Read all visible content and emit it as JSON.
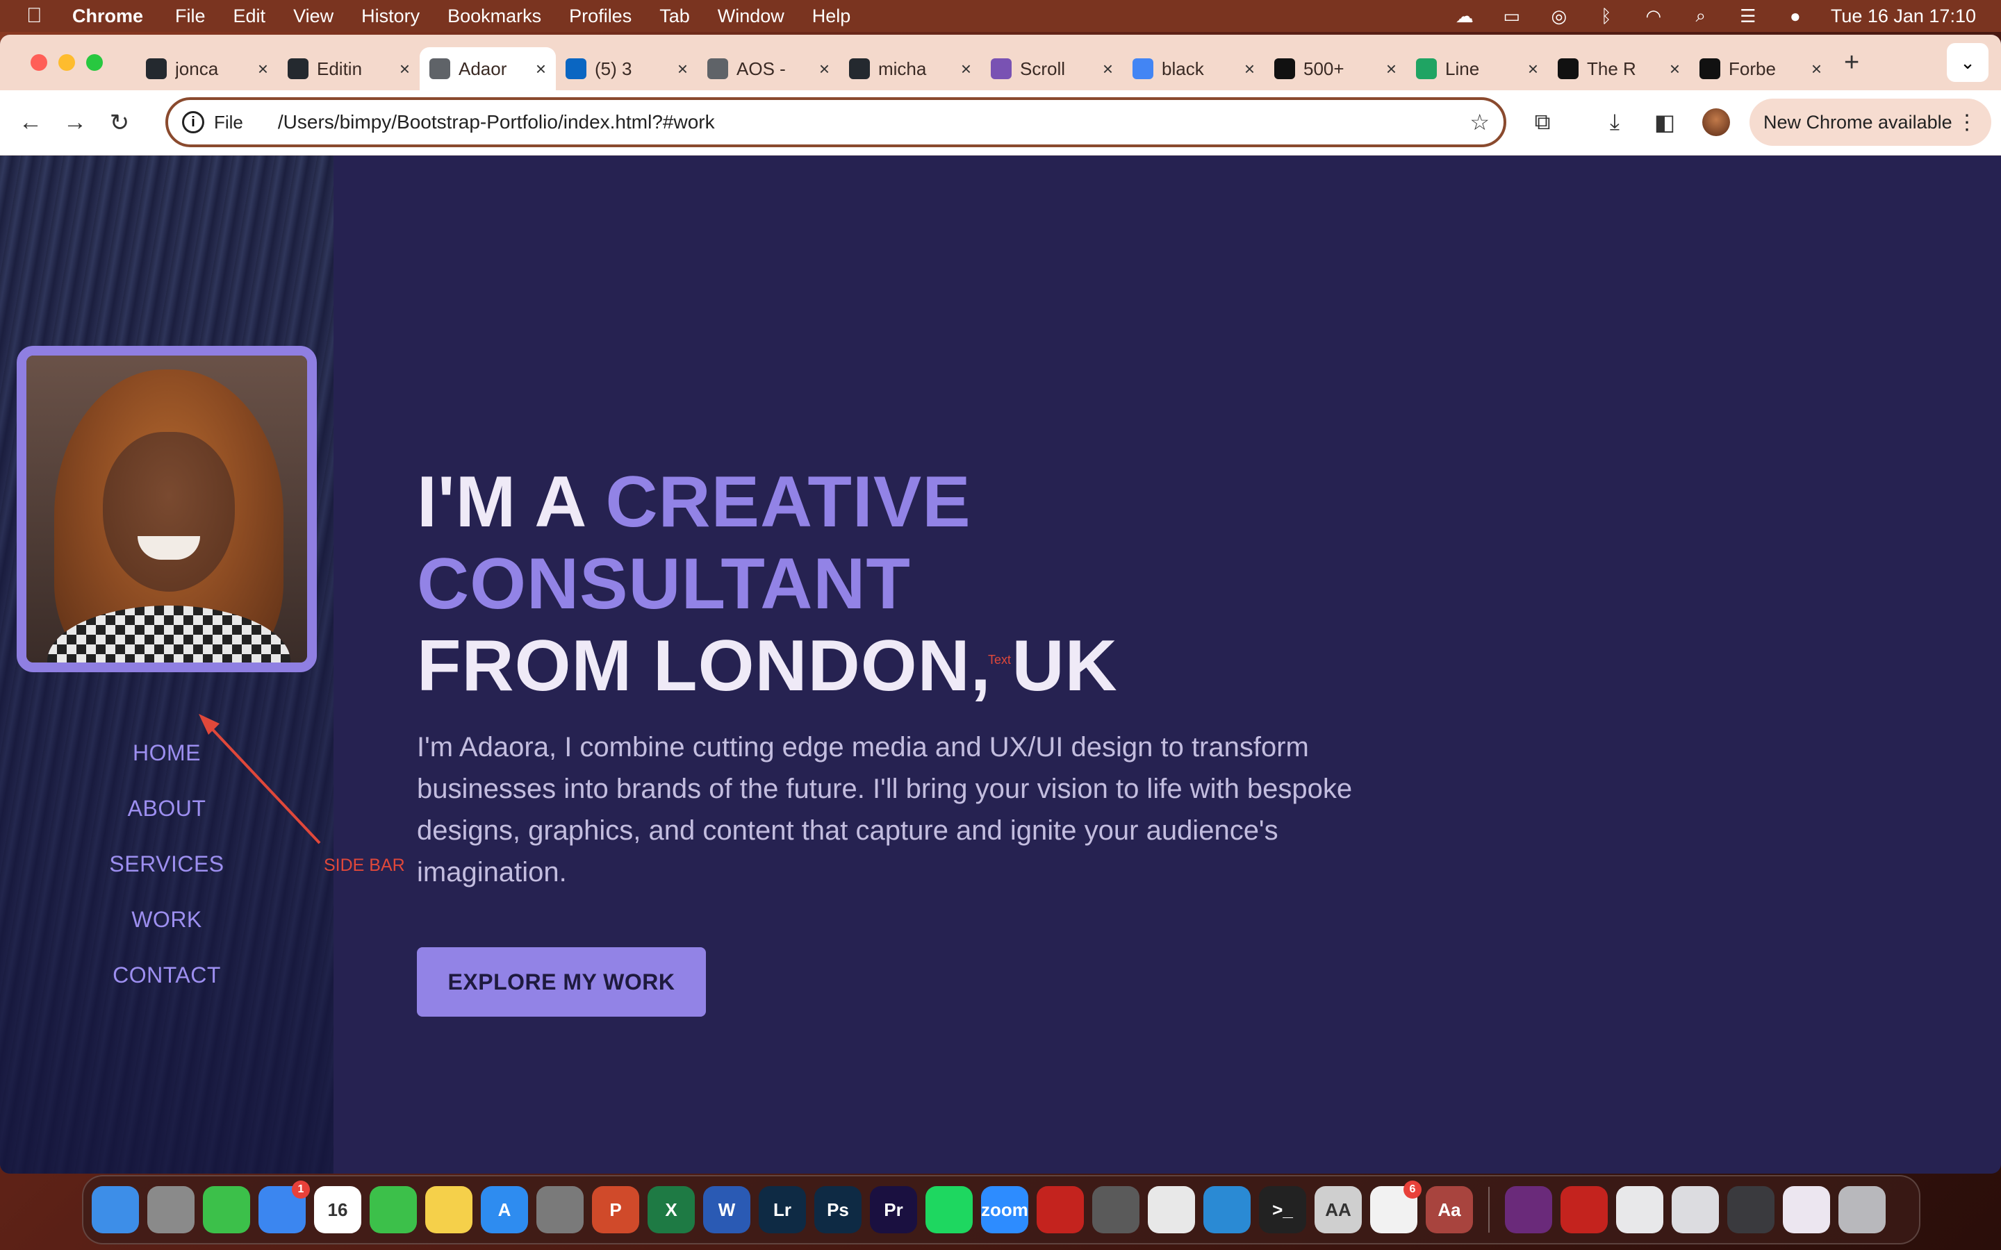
{
  "menubar": {
    "app": "Chrome",
    "items": [
      "File",
      "Edit",
      "View",
      "History",
      "Bookmarks",
      "Profiles",
      "Tab",
      "Window",
      "Help"
    ],
    "clock": "Tue 16 Jan  17:10"
  },
  "tabs": [
    {
      "label": "jonca",
      "icon": "github-icon",
      "color": "#24292f"
    },
    {
      "label": "Editin",
      "icon": "github-icon",
      "color": "#24292f"
    },
    {
      "label": "Adaor",
      "icon": "globe-icon",
      "color": "#5f6368",
      "active": true
    },
    {
      "label": "(5) 3",
      "icon": "linkedin-icon",
      "color": "#0a66c2"
    },
    {
      "label": "AOS -",
      "icon": "globe-icon",
      "color": "#5f6368"
    },
    {
      "label": "micha",
      "icon": "github-icon",
      "color": "#24292f"
    },
    {
      "label": "Scroll",
      "icon": "bootstrap-icon",
      "color": "#7952b3"
    },
    {
      "label": "black",
      "icon": "google-icon",
      "color": "#4285f4"
    },
    {
      "label": "500+",
      "icon": "unsplash-icon",
      "color": "#111111"
    },
    {
      "label": "Line",
      "icon": "sheets-icon",
      "color": "#1fa463"
    },
    {
      "label": "The R",
      "icon": "medium-icon",
      "color": "#111111"
    },
    {
      "label": "Forbe",
      "icon": "forbes-icon",
      "color": "#111111"
    }
  ],
  "omnibox": {
    "scheme": "File",
    "url": "/Users/bimpy/Bootstrap-Portfolio/index.html?#work"
  },
  "update_label": "New Chrome available",
  "sidebar": {
    "nav": [
      "HOME",
      "ABOUT",
      "SERVICES",
      "WORK",
      "CONTACT"
    ]
  },
  "hero": {
    "line1_prefix": "I'M A ",
    "line1_accent": "CREATIVE CONSULTANT",
    "line2": "FROM LONDON, UK",
    "body": "I'm Adaora, I combine cutting edge media and UX/UI design to transform businesses into brands of the future. I'll bring your vision to life with bespoke designs, graphics, and content that capture and ignite your audience's imagination.",
    "cta": "EXPLORE MY WORK"
  },
  "annotations": {
    "sidebar_label": "SIDE BAR",
    "text_label": "Text"
  },
  "colors": {
    "accent": "#9283e6",
    "page_bg": "#262251",
    "annotation": "#e0483a"
  },
  "dock": {
    "apps": [
      {
        "name": "finder-icon",
        "label": "",
        "color": "#3d8ee8"
      },
      {
        "name": "launchpad-icon",
        "label": "",
        "color": "#8a8a8a"
      },
      {
        "name": "messages-icon",
        "label": "",
        "color": "#3cc04a"
      },
      {
        "name": "mail-icon",
        "label": "",
        "color": "#3b86f0",
        "badge": "1"
      },
      {
        "name": "calendar-icon",
        "label": "16",
        "color": "#ffffff"
      },
      {
        "name": "facetime-icon",
        "label": "",
        "color": "#3cc04a"
      },
      {
        "name": "notes-icon",
        "label": "",
        "color": "#f5d04a"
      },
      {
        "name": "app-store-icon",
        "label": "A",
        "color": "#2e8cf0"
      },
      {
        "name": "system-settings-icon",
        "label": "",
        "color": "#7a7a7a"
      },
      {
        "name": "powerpoint-icon",
        "label": "P",
        "color": "#d04a2a"
      },
      {
        "name": "excel-icon",
        "label": "X",
        "color": "#1e7a44"
      },
      {
        "name": "word-icon",
        "label": "W",
        "color": "#2a5ab4"
      },
      {
        "name": "lightroom-icon",
        "label": "Lr",
        "color": "#0e2a44"
      },
      {
        "name": "photoshop-icon",
        "label": "Ps",
        "color": "#0e2a44"
      },
      {
        "name": "premiere-icon",
        "label": "Pr",
        "color": "#1a1040"
      },
      {
        "name": "spotify-icon",
        "label": "",
        "color": "#1ed760"
      },
      {
        "name": "zoom-icon",
        "label": "zoom",
        "color": "#2d8cff"
      },
      {
        "name": "acrobat-icon",
        "label": "",
        "color": "#c4231e"
      },
      {
        "name": "calculator-icon",
        "label": "",
        "color": "#5a5a5a"
      },
      {
        "name": "chrome-icon",
        "label": "",
        "color": "#e8e8e8"
      },
      {
        "name": "vscode-icon",
        "label": "",
        "color": "#2a8ad4"
      },
      {
        "name": "terminal-icon",
        "label": ">_",
        "color": "#222222"
      },
      {
        "name": "font-book-icon",
        "label": "AA",
        "color": "#cfcfcf"
      },
      {
        "name": "reminders-icon",
        "label": "",
        "color": "#f2f2f2",
        "badge": "6"
      },
      {
        "name": "dictionary-icon",
        "label": "Aa",
        "color": "#a8443e"
      }
    ],
    "recent": [
      {
        "name": "recent-image-icon",
        "color": "#6a2a7a"
      },
      {
        "name": "recent-acrobat-icon",
        "color": "#c4231e"
      },
      {
        "name": "recent-window-1-icon",
        "color": "#e8e8ea"
      },
      {
        "name": "recent-window-2-icon",
        "color": "#dcdce0"
      },
      {
        "name": "recent-window-3-icon",
        "color": "#3a3a3e"
      },
      {
        "name": "recent-window-4-icon",
        "color": "#ece6f0"
      },
      {
        "name": "trash-icon",
        "color": "#b8b8bc"
      }
    ]
  }
}
